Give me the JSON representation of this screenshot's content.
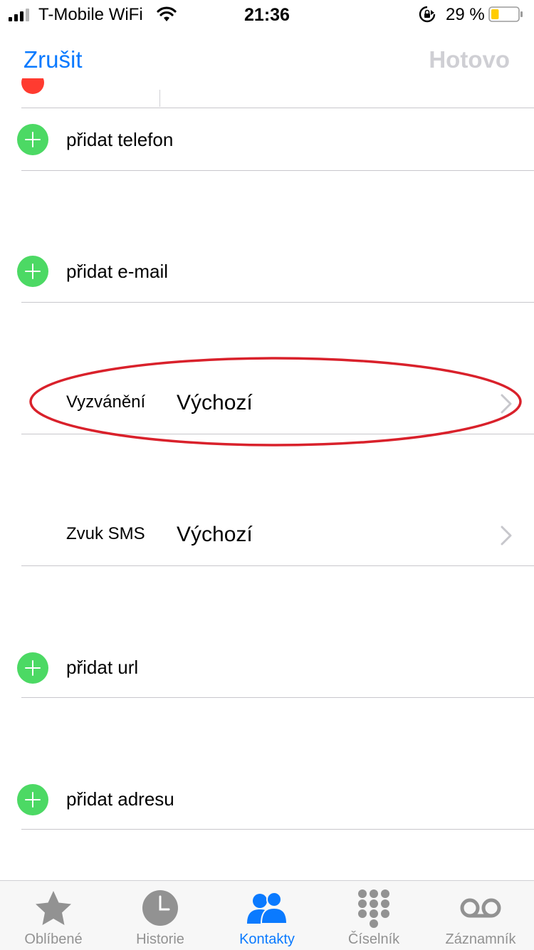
{
  "status_bar": {
    "carrier": "T-Mobile WiFi",
    "time": "21:36",
    "battery_percent": "29 %",
    "battery_level": 0.29,
    "battery_color": "#ffcc00"
  },
  "nav": {
    "cancel_label": "Zrušit",
    "done_label": "Hotovo"
  },
  "rows": {
    "add_phone": "přidat telefon",
    "add_email": "přidat e-mail",
    "ringtone": {
      "label": "Vyzvánění",
      "value": "Výchozí"
    },
    "sms_tone": {
      "label": "Zvuk SMS",
      "value": "Výchozí"
    },
    "add_url": "přidat url",
    "add_address": "přidat adresu"
  },
  "icons": {
    "add": "plus-circle-icon",
    "chevron": "chevron-right-icon"
  },
  "colors": {
    "accent": "#0a7aff",
    "add_green": "#4cd964",
    "highlight_red": "#d9212b",
    "done_disabled": "#cfcfd4",
    "tab_inactive": "#929292"
  },
  "tab_bar": {
    "tabs": [
      {
        "label": "Oblíbené",
        "icon": "star-icon",
        "active": false
      },
      {
        "label": "Historie",
        "icon": "clock-icon",
        "active": false
      },
      {
        "label": "Kontakty",
        "icon": "contacts-icon",
        "active": true
      },
      {
        "label": "Číselník",
        "icon": "keypad-icon",
        "active": false
      },
      {
        "label": "Záznamník",
        "icon": "voicemail-icon",
        "active": false
      }
    ]
  }
}
